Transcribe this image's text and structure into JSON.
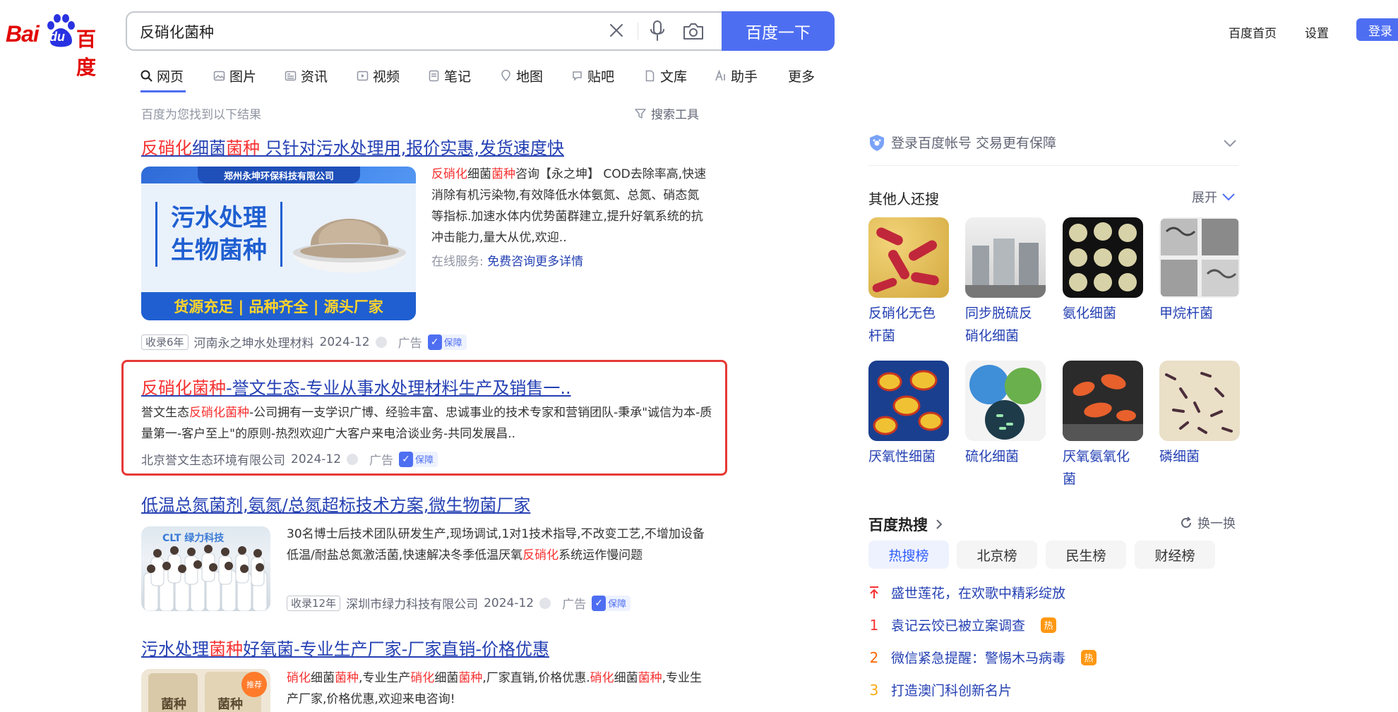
{
  "colors": {
    "brand_red": "#e10602",
    "link_blue": "#2440b3",
    "accent_blue": "#4e6ef2",
    "highlight_red": "#f73131",
    "ad_box_red": "#e53935"
  },
  "header": {
    "logo": {
      "latin": "Bai",
      "paw_text": "du",
      "chinese": "百度"
    },
    "search": {
      "query": "反硝化菌种",
      "button_label": "百度一下"
    },
    "icons": [
      "close-icon",
      "microphone-icon",
      "camera-icon"
    ],
    "top_links": {
      "home": "百度首页",
      "settings": "设置",
      "login": "登录"
    }
  },
  "tabs": [
    {
      "label": "网页",
      "icon": "search-icon"
    },
    {
      "label": "图片",
      "icon": "image-icon"
    },
    {
      "label": "资讯",
      "icon": "news-icon"
    },
    {
      "label": "视频",
      "icon": "video-icon"
    },
    {
      "label": "笔记",
      "icon": "note-icon"
    },
    {
      "label": "地图",
      "icon": "map-icon"
    },
    {
      "label": "贴吧",
      "icon": "tieba-icon"
    },
    {
      "label": "文库",
      "icon": "doc-icon"
    },
    {
      "label": "助手",
      "icon": "ai-icon"
    },
    {
      "label": "更多",
      "icon": ""
    }
  ],
  "result_info": {
    "found_text": "百度为您找到以下结果",
    "search_tools": "搜索工具"
  },
  "results": [
    {
      "title_parts": [
        "反硝化",
        "细菌",
        "菌种",
        " 只针对污水处理用,报价实惠,发货速度快"
      ],
      "image": {
        "company": "郑州永坤环保科技有限公司",
        "line1": "污水处理",
        "line2": "生物菌种",
        "banner": "货源充足 | 品种齐全 | 源头厂家"
      },
      "snippet_parts": [
        "反硝化",
        "细菌",
        "菌种",
        "咨询【永之坤】 COD去除率高,快速消除有机污染物,有效降低水体氨氮、总氮、硝态氮等指标.加速水体内优势菌群建立,提升好氧系统的抗冲击能力,量大从优,欢迎.."
      ],
      "service_label": "在线服务:",
      "service_link": "免费咨询更多详情",
      "age": "收录6年",
      "source": "河南永之坤水处理材料",
      "date": "2024-12",
      "ad": "广告",
      "guarantee": "保障"
    },
    {
      "title_parts": [
        "反硝化菌种",
        "-誉文生态-专业从事水处理材料生产及销售一.."
      ],
      "snippet_parts": [
        "誉文生态",
        "反硝化菌种",
        "-公司拥有一支学识广博、经验丰富、忠诚事业的技术专家和营销团队-秉承\"诚信为本-质量第一-客户至上\"的原则-热烈欢迎广大客户来电洽谈业务-共同发展昌.."
      ],
      "source": "北京誉文生态环境有限公司",
      "date": "2024-12",
      "ad": "广告",
      "guarantee": "保障"
    },
    {
      "title": "低温总氮菌剂,氨氮/总氮超标技术方案,微生物菌厂家",
      "image": {
        "brand": "CLT 绿力科技"
      },
      "snippet_parts": [
        "30名博士后技术团队研发生产,现场调试,1对1技术指导,不改变工艺,不增加设备低温/耐盐总氮激活菌,快速解决冬季低温厌氧",
        "反硝化",
        "系统运作慢问题"
      ],
      "age": "收录12年",
      "source": "深圳市绿力科技有限公司",
      "date": "2024-12",
      "ad": "广告",
      "guarantee": "保障"
    },
    {
      "title_parts": [
        "污水处理",
        "菌种",
        "好氧菌-专业生产厂家-厂家直销-价格优惠"
      ],
      "image": {
        "label1": "菌种",
        "label2": "菌种",
        "tag": "推荐"
      },
      "snippet_parts": [
        "硝化",
        "细菌",
        "菌种",
        ",专业生产",
        "硝化",
        "细菌",
        "菌种",
        ",厂家直销,价格优惠.",
        "硝化",
        "细菌",
        "菌种",
        ",",
        "专业生产厂家,价格优惠,欢迎来电咨询!"
      ]
    }
  ],
  "sidebar": {
    "account_prompt": "登录百度帐号 交易更有保障",
    "related": {
      "title": "其他人还搜",
      "expand": "展开",
      "items": [
        {
          "line1": "反硝化无色",
          "line2": "杆菌"
        },
        {
          "line1": "同步脱硫反",
          "line2": "硝化细菌"
        },
        {
          "line1": "氨化细菌",
          "line2": ""
        },
        {
          "line1": "甲烷杆菌",
          "line2": ""
        },
        {
          "line1": "厌氧性细菌",
          "line2": ""
        },
        {
          "line1": "硫化细菌",
          "line2": ""
        },
        {
          "line1": "厌氧氨氧化",
          "line2": "菌"
        },
        {
          "line1": "磷细菌",
          "line2": ""
        }
      ]
    },
    "hot": {
      "title": "百度热搜",
      "refresh": "换一换",
      "tabs": [
        "热搜榜",
        "北京榜",
        "民生榜",
        "财经榜"
      ],
      "items": [
        {
          "rank": "",
          "text": "盛世莲花，在欢歌中精彩绽放",
          "badge": "",
          "rank_color": "#f73131"
        },
        {
          "rank": "1",
          "text": "袁记云饺已被立案调查",
          "badge": "热",
          "rank_color": "#f73131"
        },
        {
          "rank": "2",
          "text": "微信紧急提醒：警惕木马病毒",
          "badge": "热",
          "rank_color": "#ff6600"
        },
        {
          "rank": "3",
          "text": "打造澳门科创新名片",
          "badge": "",
          "rank_color": "#faa90e"
        }
      ]
    }
  }
}
